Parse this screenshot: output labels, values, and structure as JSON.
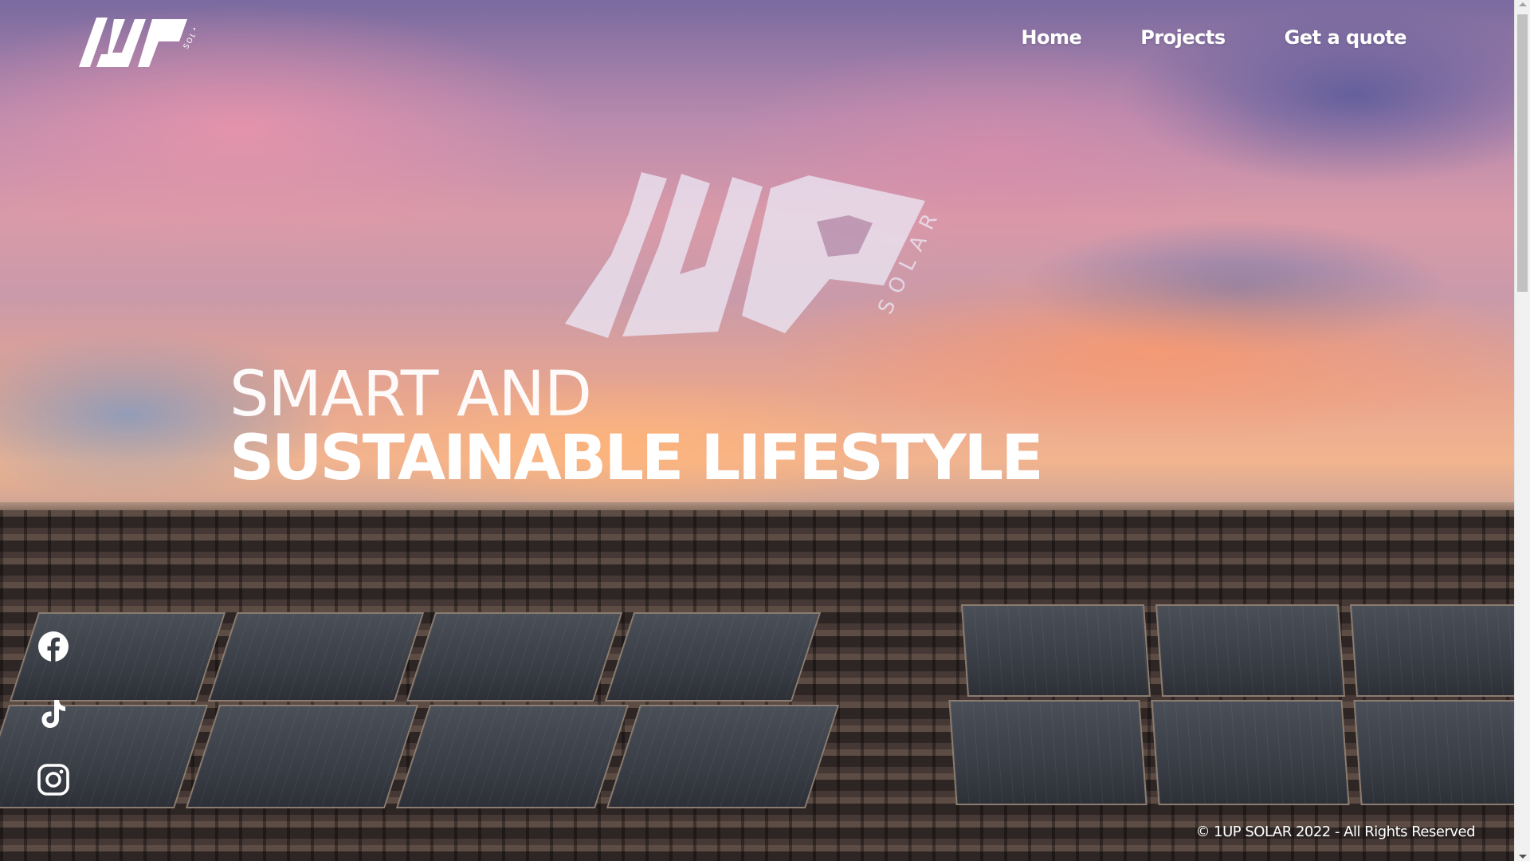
{
  "header": {
    "logo": {
      "mark": "1UP",
      "word": "SOLAR"
    },
    "nav": [
      {
        "label": "Home"
      },
      {
        "label": "Projects"
      },
      {
        "label": "Get a quote"
      }
    ]
  },
  "hero": {
    "logo": {
      "mark": "1UP",
      "word": "SOLAR"
    },
    "line1": "SMART AND",
    "line2": "SUSTAINABLE LIFESTYLE"
  },
  "social": [
    {
      "icon": "facebook-icon"
    },
    {
      "icon": "tiktok-icon"
    },
    {
      "icon": "instagram-icon"
    }
  ],
  "footer": {
    "copyright": "© 1UP SOLAR 2022 - All Rights Reserved"
  },
  "colors": {
    "text": "#ffffff",
    "scrollbar_track": "#f1f1f1",
    "scrollbar_thumb": "#c1c1c1"
  }
}
